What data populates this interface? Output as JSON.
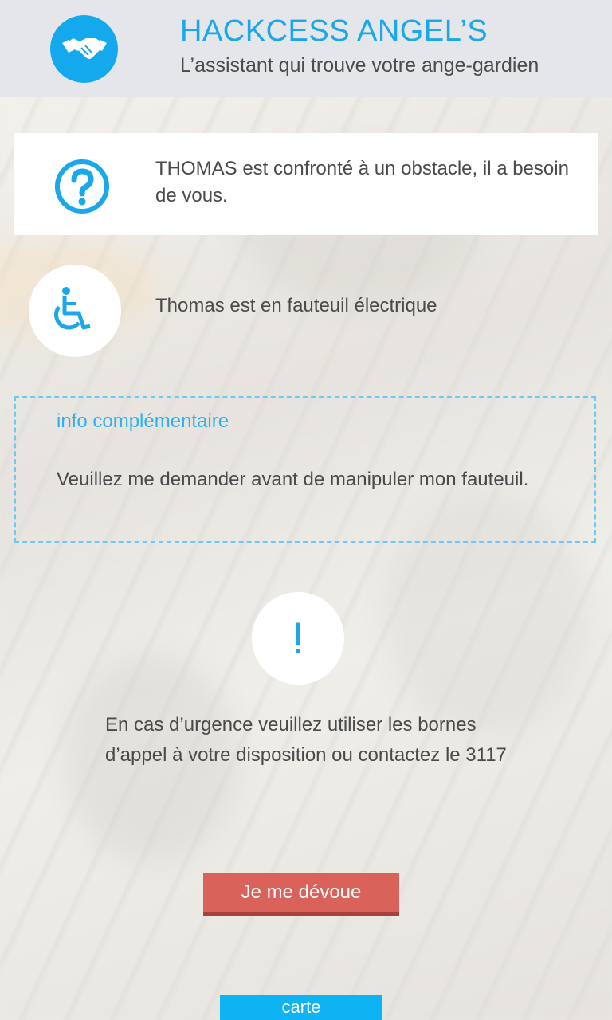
{
  "header": {
    "title": "HACKCESS ANGEL’S",
    "subtitle": "L’assistant qui trouve votre ange-gardien",
    "logo_icon": "handshake-icon"
  },
  "obstacle_card": {
    "icon": "question-mark-icon",
    "text": "THOMAS est confronté à un obstacle, il a besoin de vous."
  },
  "disability": {
    "icon": "wheelchair-icon",
    "text": "Thomas est en fauteuil électrique"
  },
  "info": {
    "label": "info complémentaire",
    "text": "Veuillez me demander avant de manipuler mon fauteuil."
  },
  "emergency": {
    "icon": "exclamation-icon",
    "mark": "!",
    "text": "En cas d’urgence veuillez utiliser les bornes d’appel à votre disposition ou contactez le 3117"
  },
  "actions": {
    "devote_label": "Je me dévoue",
    "map_label": "carte"
  },
  "colors": {
    "accent": "#1aa8ea",
    "devote_button": "#d9625a",
    "map_button": "#0db3f3"
  }
}
